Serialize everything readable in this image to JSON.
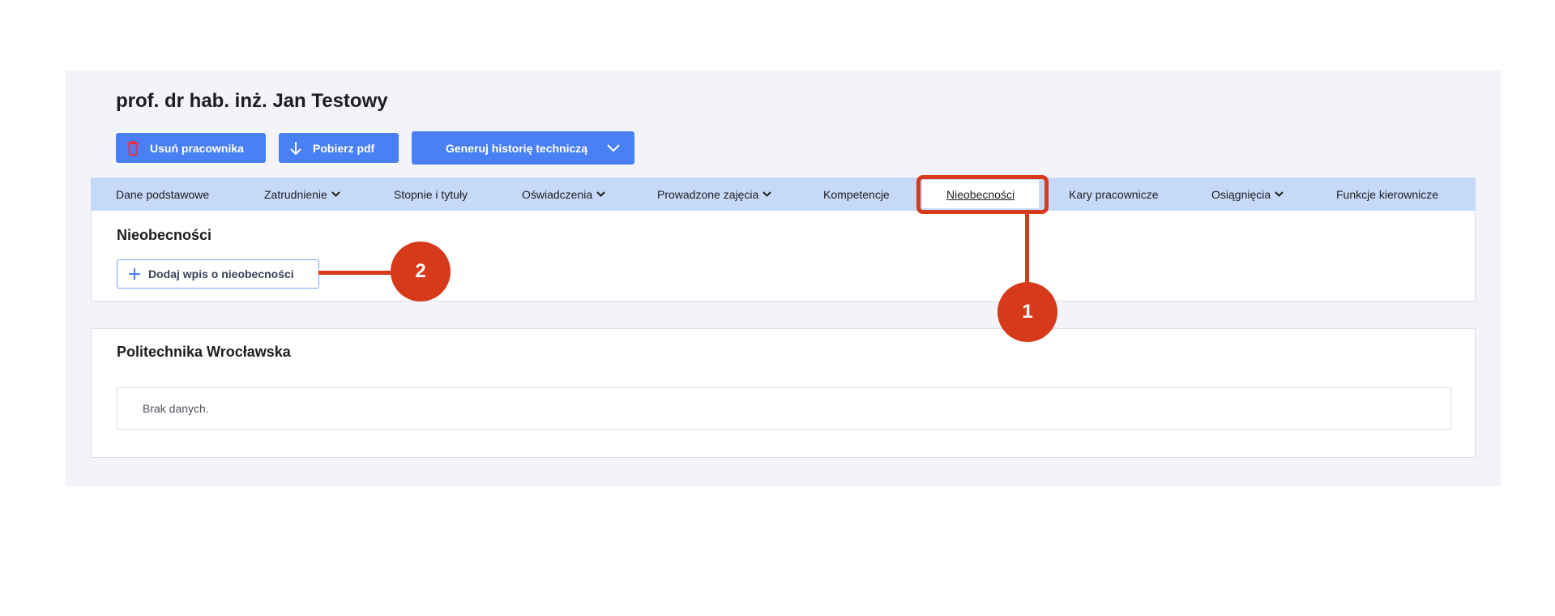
{
  "header": {
    "title": "prof. dr hab. inż. Jan Testowy"
  },
  "toolbar": {
    "delete_label": "Usuń pracownika",
    "pdf_label": "Pobierz pdf",
    "generate_label": "Generuj historię techniczą"
  },
  "tabs": [
    {
      "label": "Dane podstawowe"
    },
    {
      "label": "Zatrudnienie"
    },
    {
      "label": "Stopnie i tytuły"
    },
    {
      "label": "Oświadczenia"
    },
    {
      "label": "Prowadzone zajęcia"
    },
    {
      "label": "Kompetencje"
    },
    {
      "label": "Nieobecności"
    },
    {
      "label": "Kary pracownicze"
    },
    {
      "label": "Osiągnięcia"
    },
    {
      "label": "Funkcje kierownicze"
    }
  ],
  "absences": {
    "title": "Nieobecności",
    "add_label": "Dodaj wpis o nieobecności"
  },
  "institution": {
    "title": "Politechnika Wrocławska",
    "empty_text": "Brak danych."
  },
  "callouts": {
    "one": "1",
    "two": "2"
  },
  "colors": {
    "accent": "#4a80f5",
    "tab_bar": "#c7d9f9",
    "callout": "#d63a1a",
    "delete_icon": "#e8324a"
  }
}
